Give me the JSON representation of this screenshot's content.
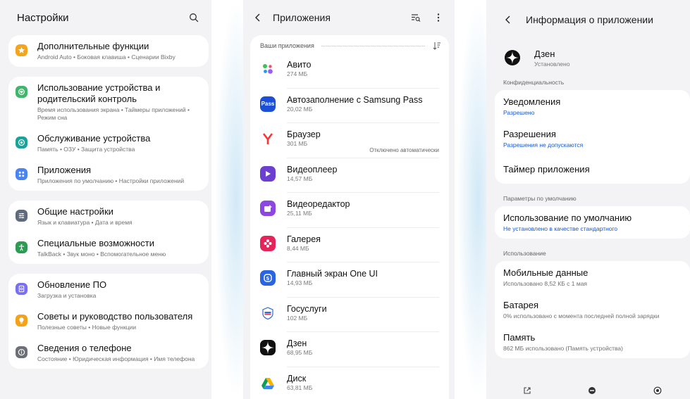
{
  "settings": {
    "title": "Настройки",
    "groups": [
      [
        {
          "title": "Дополнительные функции",
          "sub": "Android Auto • Боковая клавиша • Сценарии Bixby",
          "icon": "star-icon",
          "color": "#f4a51c"
        }
      ],
      [
        {
          "title": "Использование устройства и родительский контроль",
          "sub": "Время использования экрана • Таймеры приложений • Режим сна",
          "icon": "wellbeing-icon",
          "color": "#3fb66b"
        },
        {
          "title": "Обслуживание устройства",
          "sub": "Память • ОЗУ • Защита устройства",
          "icon": "care-icon",
          "color": "#1aa39a"
        },
        {
          "title": "Приложения",
          "sub": "Приложения по умолчанию • Настройки приложений",
          "icon": "apps-grid-icon",
          "color": "#4a84f0"
        }
      ],
      [
        {
          "title": "Общие настройки",
          "sub": "Язык и клавиатура • Дата и время",
          "icon": "sliders-icon",
          "color": "#5f6b7c"
        },
        {
          "title": "Специальные возможности",
          "sub": "TalkBack • Звук моно • Вспомогательное меню",
          "icon": "accessibility-icon",
          "color": "#2e9b55"
        }
      ],
      [
        {
          "title": "Обновление ПО",
          "sub": "Загрузка и установка",
          "icon": "update-icon",
          "color": "#7a6ff0"
        },
        {
          "title": "Советы и руководство пользователя",
          "sub": "Полезные советы • Новые функции",
          "icon": "tips-icon",
          "color": "#f2a31b"
        },
        {
          "title": "Сведения о телефоне",
          "sub": "Состояние • Юридическая информация • Имя телефона",
          "icon": "info-icon",
          "color": "#6b6f76"
        }
      ]
    ]
  },
  "apps": {
    "title": "Приложения",
    "section_label": "Ваши приложения",
    "list": [
      {
        "name": "Авито",
        "size": "274 МБ",
        "note": "",
        "icon": "avito-icon",
        "color": "#ffffff",
        "label": ""
      },
      {
        "name": "Автозаполнение с Samsung Pass",
        "size": "20,02 МБ",
        "note": "",
        "icon": "samsung-pass-icon",
        "color": "#1c4fd6",
        "label": "Pass"
      },
      {
        "name": "Браузер",
        "size": "301 МБ",
        "note": "Отключено автоматически",
        "icon": "yandex-browser-icon",
        "color": "#ffffff",
        "label": "Y"
      },
      {
        "name": "Видеоплеер",
        "size": "14,57 МБ",
        "note": "",
        "icon": "video-player-icon",
        "color": "#6c3fd1",
        "label": ""
      },
      {
        "name": "Видеоредактор",
        "size": "25,11 МБ",
        "note": "",
        "icon": "video-editor-icon",
        "color": "#8b47e0",
        "label": ""
      },
      {
        "name": "Галерея",
        "size": "8,44 МБ",
        "note": "",
        "icon": "gallery-icon",
        "color": "#e5245a",
        "label": ""
      },
      {
        "name": "Главный экран One UI",
        "size": "14,93 МБ",
        "note": "",
        "icon": "one-ui-home-icon",
        "color": "#2a64e0",
        "label": ""
      },
      {
        "name": "Госуслуги",
        "size": "102 МБ",
        "note": "",
        "icon": "gosuslugi-icon",
        "color": "#ffffff",
        "label": ""
      },
      {
        "name": "Дзен",
        "size": "68,95 МБ",
        "note": "",
        "icon": "dzen-icon",
        "color": "#111111",
        "label": ""
      },
      {
        "name": "Диск",
        "size": "63,81 МБ",
        "note": "",
        "icon": "drive-icon",
        "color": "#ffffff",
        "label": ""
      }
    ]
  },
  "app_info": {
    "title": "Информация о приложении",
    "app_name": "Дзен",
    "app_status": "Установлено",
    "privacy_label": "Конфиденциальность",
    "notifications": {
      "title": "Уведомления",
      "sub": "Разрешено"
    },
    "permissions": {
      "title": "Разрешения",
      "sub": "Разрешения не допускаются"
    },
    "timer": {
      "title": "Таймер приложения"
    },
    "defaults_label": "Параметры по умолчанию",
    "default_use": {
      "title": "Использование по умолчанию",
      "sub": "Не установлено в качестве стандартного"
    },
    "usage_label": "Использование",
    "mobile_data": {
      "title": "Мобильные данные",
      "sub": "Использовано 8,52 КБ с 1 мая"
    },
    "battery": {
      "title": "Батарея",
      "sub": "0% использовано с момента последней полной зарядки"
    },
    "storage": {
      "title": "Память",
      "sub": "862 МБ использовано (Память устройства)"
    }
  }
}
